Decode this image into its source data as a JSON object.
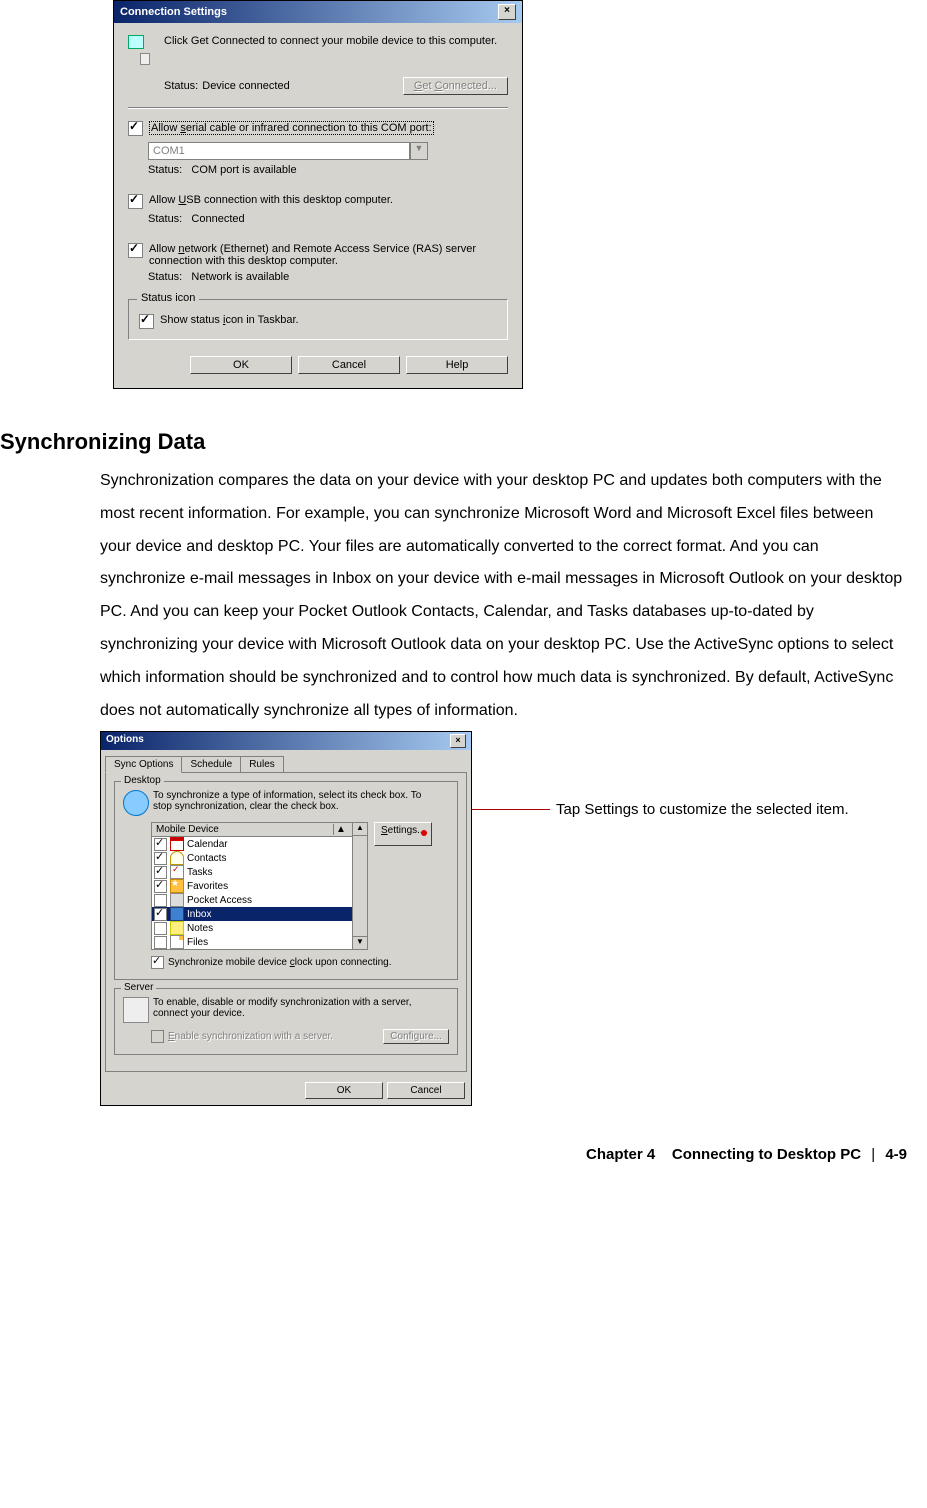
{
  "dialog1": {
    "title": "Connection Settings",
    "intro": "Click Get Connected to connect your mobile device to this computer.",
    "status_label": "Status:",
    "status_value": "Device connected",
    "get_connected": "Get Connected...",
    "serial_label_pre": "Allow ",
    "serial_u": "s",
    "serial_label_post": "erial cable or infrared connection to this COM port:",
    "com_value": "COM1",
    "com_status_label": "Status:",
    "com_status_value": "COM port is available",
    "usb_pre": "Allow ",
    "usb_u": "U",
    "usb_post": "SB connection with this desktop computer.",
    "usb_status_label": "Status:",
    "usb_status_value": "Connected",
    "net_pre": "Allow ",
    "net_u": "n",
    "net_post": "etwork (Ethernet) and Remote Access Service (RAS) server connection with this desktop computer.",
    "net_status_label": "Status:",
    "net_status_value": "Network is available",
    "fieldset_legend": "Status icon",
    "taskbar_pre": "Show status ",
    "taskbar_u": "i",
    "taskbar_post": "con in Taskbar.",
    "ok": "OK",
    "cancel": "Cancel",
    "help": "Help"
  },
  "section_heading": "Synchronizing Data",
  "body_paragraph": "Synchronization compares the data on your device with your desktop PC and updates both computers with the most recent information. For example, you can synchronize Microsoft Word and Microsoft Excel files between your device and desktop PC. Your files are automatically converted to the correct format. And you can synchronize e-mail messages in Inbox on your device with e-mail messages in Microsoft Outlook on your desktop PC. And you can keep your Pocket Outlook Contacts, Calendar, and Tasks databases up-to-dated by synchronizing your device with Microsoft Outlook data on your desktop PC. Use the ActiveSync options to select which information should be synchronized and to control how much data is synchronized. By default, ActiveSync does not automatically synchronize all types of information.",
  "dialog2": {
    "title": "Options",
    "tab1": "Sync Options",
    "tab2": "Schedule",
    "tab3": "Rules",
    "desktop_legend": "Desktop",
    "desktop_text": "To synchronize a type of information, select its check box. To stop synchronization, clear the check box.",
    "list_header": "Mobile Device",
    "settings_btn_pre": "",
    "settings_u": "S",
    "settings_btn_post": "ettings...",
    "items": {
      "calendar": "Calendar",
      "contacts": "Contacts",
      "tasks": "Tasks",
      "favorites": "Favorites",
      "pocket": "Pocket Access",
      "inbox": "Inbox",
      "notes": "Notes",
      "files": "Files"
    },
    "sync_clock_pre": "Synchronize mobile device ",
    "sync_clock_u": "c",
    "sync_clock_post": "lock upon connecting.",
    "server_legend": "Server",
    "server_text": "To enable, disable or modify synchronization with a server, connect your device.",
    "enable_pre": "",
    "enable_u": "E",
    "enable_post": "nable synchronization with a server.",
    "configure": "Configure...",
    "ok": "OK",
    "cancel": "Cancel"
  },
  "callout_text": "Tap Settings to customize the selected item.",
  "footer": {
    "chapter": "Chapter 4",
    "title": "Connecting to Desktop PC",
    "page": "4-9"
  }
}
